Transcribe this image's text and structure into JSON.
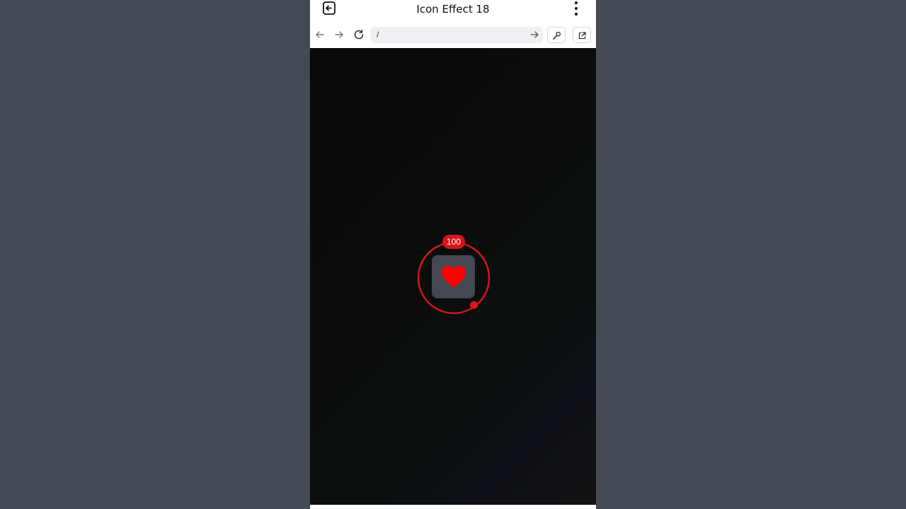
{
  "window": {
    "title": "Icon Effect 18"
  },
  "nav": {
    "url": "/"
  },
  "effect": {
    "count": "100",
    "progress_fraction": 0.85
  },
  "colors": {
    "ring": "#d5151b",
    "heart": "#ff0000",
    "card": "#454851",
    "background": "#0a0d0c",
    "page_outer": "#444a54"
  },
  "icons": {
    "exit": "exit-icon",
    "menu": "kebab-menu-icon",
    "back": "arrow-left-icon",
    "forward": "arrow-right-icon",
    "reload": "reload-icon",
    "go": "arrow-right-icon",
    "tools": "wrench-icon",
    "external": "external-link-icon",
    "main": "heart-icon"
  }
}
